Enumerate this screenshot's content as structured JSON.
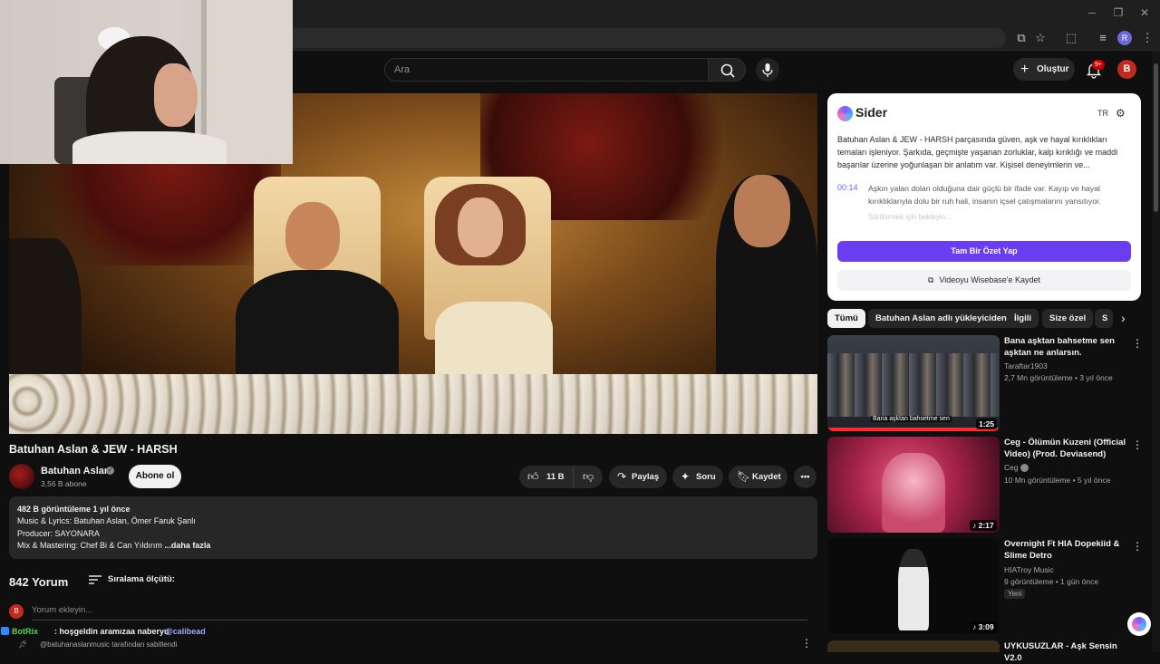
{
  "header": {
    "search_placeholder": "Ara",
    "create_label": "Oluştur",
    "notif_badge": "9+",
    "account_initial": "B",
    "profile_initial": "R"
  },
  "video": {
    "title": "Batuhan Aslan & JEW - HARSH",
    "channel": "Batuhan Aslan",
    "subscribers": "3,56 B abone",
    "subscribe_label": "Abone ol",
    "likes": "11 B",
    "share_label": "Paylaş",
    "ask_label": "Soru",
    "save_label": "Kaydet"
  },
  "description": {
    "meta": "482 B görüntüleme  1 yıl önce",
    "lines": [
      "Music & Lyrics: Batuhan Aslan, Ömer Faruk Şanlı",
      "Producer: SAYONARA",
      "Mix & Mastering: Chef Bi  & Can Yıldırım"
    ],
    "more": "...daha fazla"
  },
  "comments": {
    "count": "842 Yorum",
    "sort_label": "Sıralama ölçütü:",
    "placeholder": "Yorum ekleyin...",
    "avatar_initial": "B",
    "pinned": "@batuhanaslanmusic tarafından sabitlendi"
  },
  "chat": {
    "user": "BotRix",
    "message": ": hoşgeldin aramızaa naberyu",
    "mention": "@calibead"
  },
  "sider": {
    "title": "Sider",
    "lang": "TR",
    "summary": "Batuhan Aslan & JEW - HARSH parçasında güven, aşk ve hayal kırıklıkları temaları işleniyor. Şarkıda, geçmişte yaşanan zorluklar, kalp kırıklığı ve maddi başarılar üzerine yoğunlaşan bir anlatım var. Kişisel deneyimlerin ve...",
    "timestamp": "00:14",
    "point": "Aşkın yalan dolan olduğuna dair güçlü bir ifade var. Kayıp ve hayal kırıklıklarıyla dolu bir ruh hali, insanın içsel çatışmalarını yansıtıyor.",
    "faded": "Sürdürmek için bekleyin...",
    "primary_button": "Tam Bir Özet Yap",
    "secondary_button": "Videoyu Wisebase'e Kaydet"
  },
  "chips": [
    "Tümü",
    "Batuhan Aslan adlı yükleyiciden",
    "İlgili",
    "Size özel",
    "S"
  ],
  "recommendations": [
    {
      "title": "Bana aşktan bahsetme sen aşktan ne anlarsın.",
      "channel": "Taraftar1903",
      "meta": "2,7 Mn görüntüleme • 3 yıl önce",
      "duration": "1:25",
      "caption": "Bana aşktan bahsetme sen"
    },
    {
      "title": "Ceg - Ölümün Kuzeni (Official Video) (Prod. Deviasend)",
      "channel": "Ceg",
      "meta": "10 Mn görüntüleme • 5 yıl önce",
      "duration": "♪ 2:17"
    },
    {
      "title": "Overnight Ft HIA Dopekiid & Slime Detro",
      "channel": "HIATroy Music",
      "meta": "9 görüntüleme • 1 gün önce",
      "duration": "♪ 3:09",
      "badge": "Yeni"
    },
    {
      "title": "UYKUSUZLAR - Aşk Sensin V2.0"
    }
  ],
  "colors": {
    "background": "#0f0f0f",
    "pill": "#272727",
    "sider_accent": "#6a3df0",
    "chat_user": "#54d64f",
    "notif_red": "#cc0000"
  },
  "icons": [
    "search-icon",
    "mic-icon",
    "bell-icon",
    "plus-icon",
    "like-icon",
    "dislike-icon",
    "share-icon",
    "sparkle-icon",
    "bookmark-icon",
    "kebab-icon",
    "sort-icon",
    "gear-icon",
    "chevron-right-icon"
  ]
}
